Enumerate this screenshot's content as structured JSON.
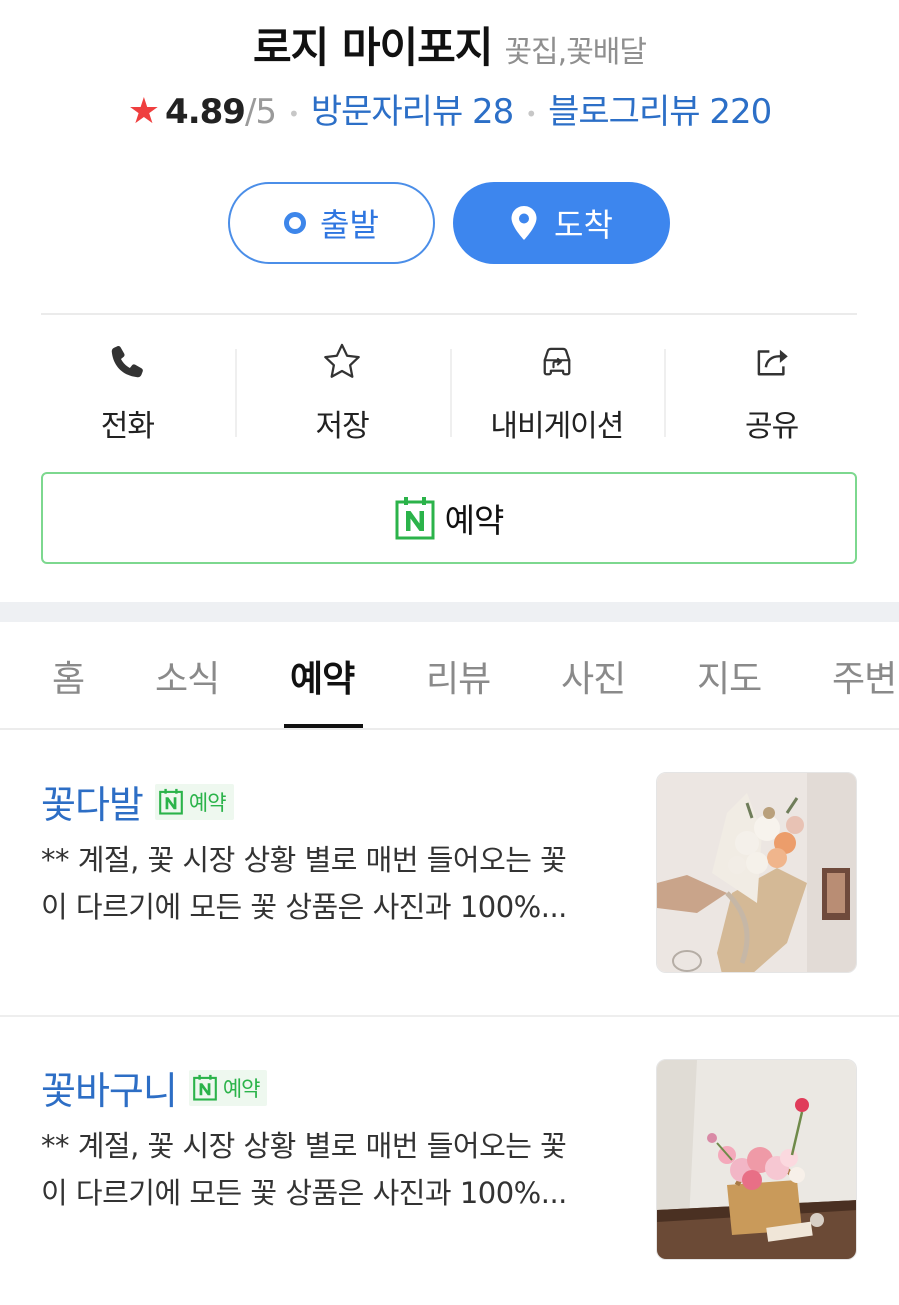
{
  "header": {
    "place_name": "로지 마이포지",
    "category": "꽃집,꽃배달",
    "rating": "4.89",
    "rating_max": "/5",
    "visitor_reviews": "방문자리뷰 28",
    "blog_reviews": "블로그리뷰 220"
  },
  "route": {
    "start_label": "출발",
    "arrive_label": "도착"
  },
  "actions": [
    {
      "label": "전화",
      "icon": "phone-icon"
    },
    {
      "label": "저장",
      "icon": "star-outline-icon"
    },
    {
      "label": "내비게이션",
      "icon": "car-navigation-icon"
    },
    {
      "label": "공유",
      "icon": "share-icon"
    }
  ],
  "reserve": {
    "label": "예약",
    "icon": "naver-booking-icon"
  },
  "tabs": [
    {
      "label": "홈",
      "active": false
    },
    {
      "label": "소식",
      "active": false
    },
    {
      "label": "예약",
      "active": true
    },
    {
      "label": "리뷰",
      "active": false
    },
    {
      "label": "사진",
      "active": false
    },
    {
      "label": "지도",
      "active": false
    },
    {
      "label": "주변",
      "active": false
    }
  ],
  "products": [
    {
      "title": "꽃다발",
      "badge": "예약",
      "desc_line1": "** 계절, 꽃 시장 상황 별로 매번 들어오는 꽃",
      "desc_line2": "이 다르기에 모든 꽃 상품은 사진과 100%...",
      "image": "bouquet-photo"
    },
    {
      "title": "꽃바구니",
      "badge": "예약",
      "desc_line1": "** 계절, 꽃 시장 상황 별로 매번 들어오는 꽃",
      "desc_line2": "이 다르기에 모든 꽃 상품은 사진과 100%...",
      "image": "flower-basket-photo"
    }
  ],
  "colors": {
    "accent_blue": "#3d86ee",
    "link_blue": "#2c6fc7",
    "star_red": "#ef3f3f",
    "naver_green": "#2bb34a"
  }
}
